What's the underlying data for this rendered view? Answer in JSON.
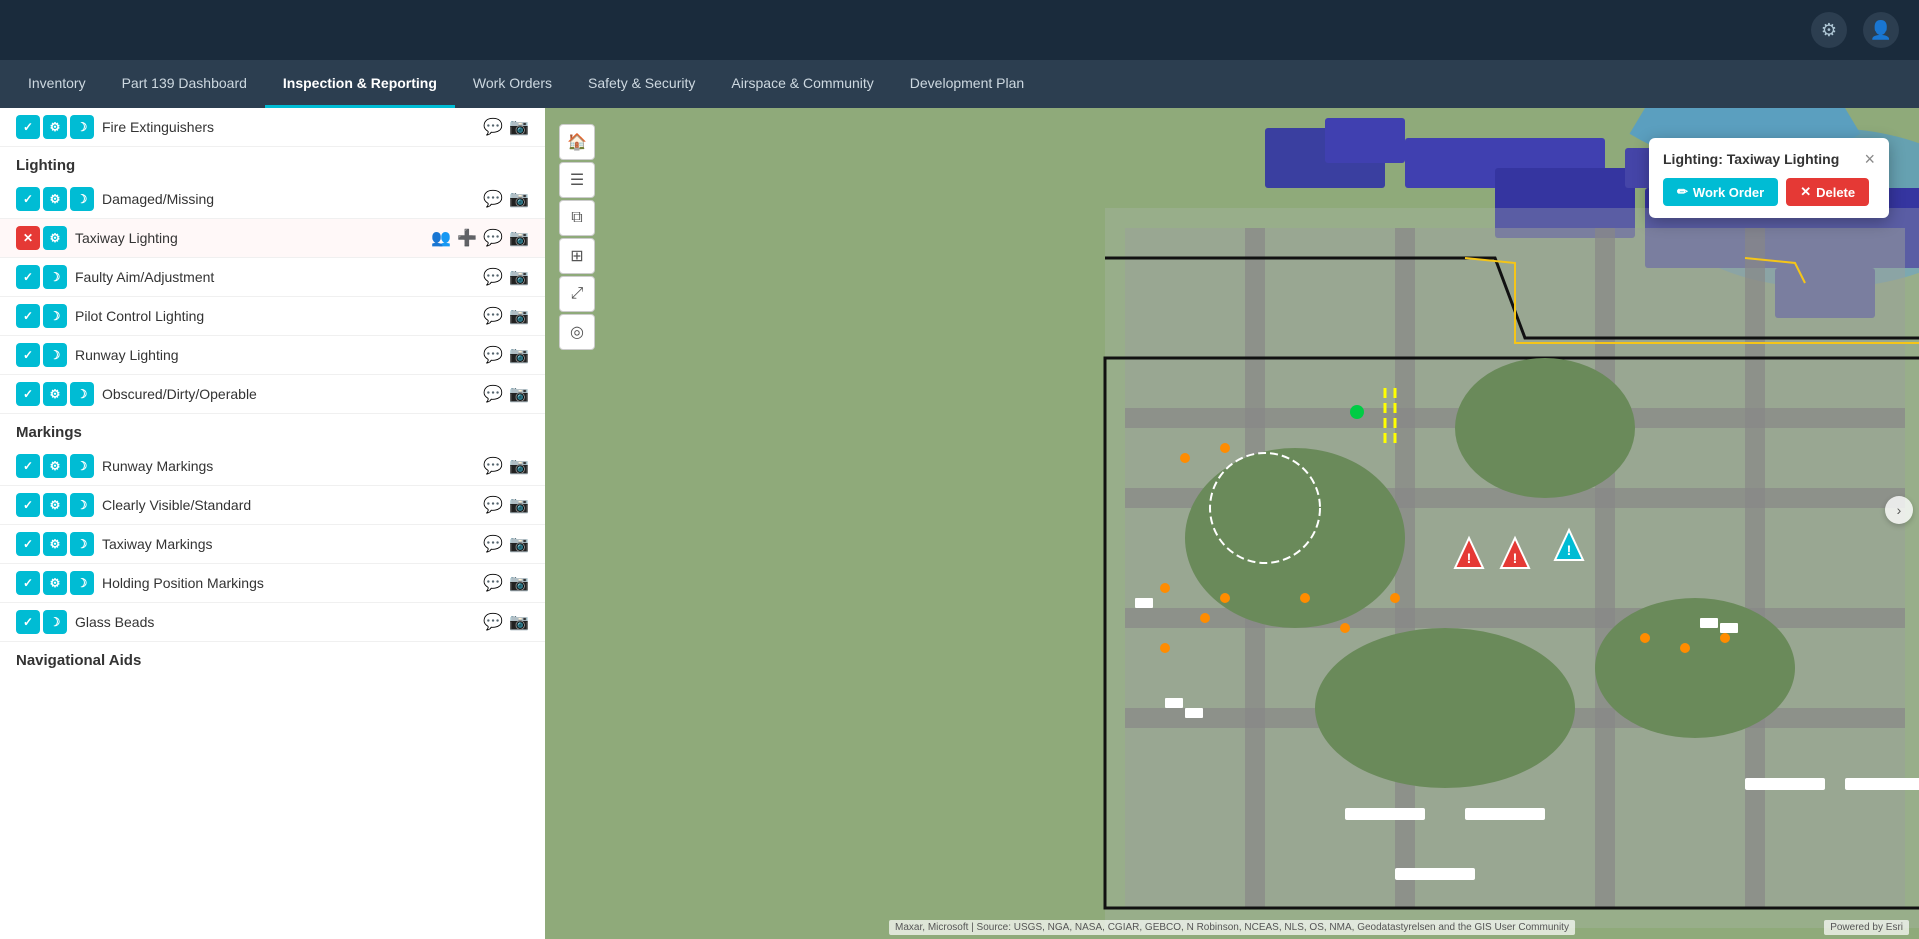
{
  "topbar": {
    "settings_icon": "⚙",
    "user_icon": "👤"
  },
  "navbar": {
    "items": [
      {
        "label": "Inventory",
        "active": false
      },
      {
        "label": "Part 139 Dashboard",
        "active": false
      },
      {
        "label": "Inspection & Reporting",
        "active": true
      },
      {
        "label": "Work Orders",
        "active": false
      },
      {
        "label": "Safety & Security",
        "active": false
      },
      {
        "label": "Airspace & Community",
        "active": false
      },
      {
        "label": "Development Plan",
        "active": false
      }
    ]
  },
  "left_panel": {
    "sections": [
      {
        "id": "lighting_top",
        "items": [
          {
            "label": "Fire Extinguishers",
            "icons": [
              "check",
              "gear",
              "moon"
            ],
            "actions": [
              "chat",
              "camera"
            ],
            "status": "normal"
          }
        ]
      },
      {
        "id": "lighting",
        "heading": "Lighting",
        "items": [
          {
            "label": "Damaged/Missing",
            "icons": [
              "check",
              "gear",
              "moon"
            ],
            "actions": [
              "chat",
              "camera"
            ],
            "status": "normal"
          },
          {
            "label": "Taxiway Lighting",
            "icons": [
              "red_x",
              "gear"
            ],
            "actions": [
              "assign",
              "add",
              "chat",
              "camera"
            ],
            "status": "alert"
          },
          {
            "label": "Faulty Aim/Adjustment",
            "icons": [
              "check",
              "moon"
            ],
            "actions": [
              "chat",
              "camera"
            ],
            "status": "normal"
          },
          {
            "label": "Pilot Control Lighting",
            "icons": [
              "check",
              "moon"
            ],
            "actions": [
              "chat",
              "camera"
            ],
            "status": "normal"
          },
          {
            "label": "Runway Lighting",
            "icons": [
              "check",
              "moon"
            ],
            "actions": [
              "chat",
              "camera"
            ],
            "status": "normal"
          },
          {
            "label": "Obscured/Dirty/Operable",
            "icons": [
              "check",
              "gear",
              "moon"
            ],
            "actions": [
              "chat",
              "camera"
            ],
            "status": "normal"
          }
        ]
      },
      {
        "id": "markings",
        "heading": "Markings",
        "items": [
          {
            "label": "Runway Markings",
            "icons": [
              "check",
              "gear",
              "moon"
            ],
            "actions": [
              "chat",
              "camera"
            ],
            "status": "normal"
          },
          {
            "label": "Clearly Visible/Standard",
            "icons": [
              "check",
              "gear",
              "moon"
            ],
            "actions": [
              "chat",
              "camera"
            ],
            "status": "normal"
          },
          {
            "label": "Taxiway Markings",
            "icons": [
              "check",
              "gear",
              "moon"
            ],
            "actions": [
              "chat",
              "camera"
            ],
            "status": "normal"
          },
          {
            "label": "Holding Position Markings",
            "icons": [
              "check",
              "gear",
              "moon"
            ],
            "actions": [
              "chat",
              "camera"
            ],
            "status": "normal"
          },
          {
            "label": "Glass Beads",
            "icons": [
              "check",
              "moon"
            ],
            "actions": [
              "chat",
              "camera"
            ],
            "status": "normal"
          }
        ]
      },
      {
        "id": "navigational",
        "heading": "Navigational Aids",
        "items": []
      }
    ]
  },
  "popup": {
    "title": "Lighting: Taxiway Lighting",
    "work_order_label": "Work Order",
    "delete_label": "Delete",
    "close_symbol": "×"
  },
  "map": {
    "toolbar_icons": [
      "🏠",
      "☰",
      "⧉",
      "⊞",
      "⤢",
      "◎"
    ],
    "markers": [
      {
        "type": "red",
        "left": "367",
        "top": "312"
      },
      {
        "type": "red",
        "left": "402",
        "top": "312"
      },
      {
        "type": "cyan",
        "left": "440",
        "top": "304"
      }
    ],
    "attribution": "Maxar, Microsoft | Source: USGS, NGA, NASA, CGIAR, GEBCO, N Robinson, NCEAS, NLS, OS, NMA, Geodatastyrelsen and the GIS User Community",
    "esri": "Powered by Esri"
  }
}
